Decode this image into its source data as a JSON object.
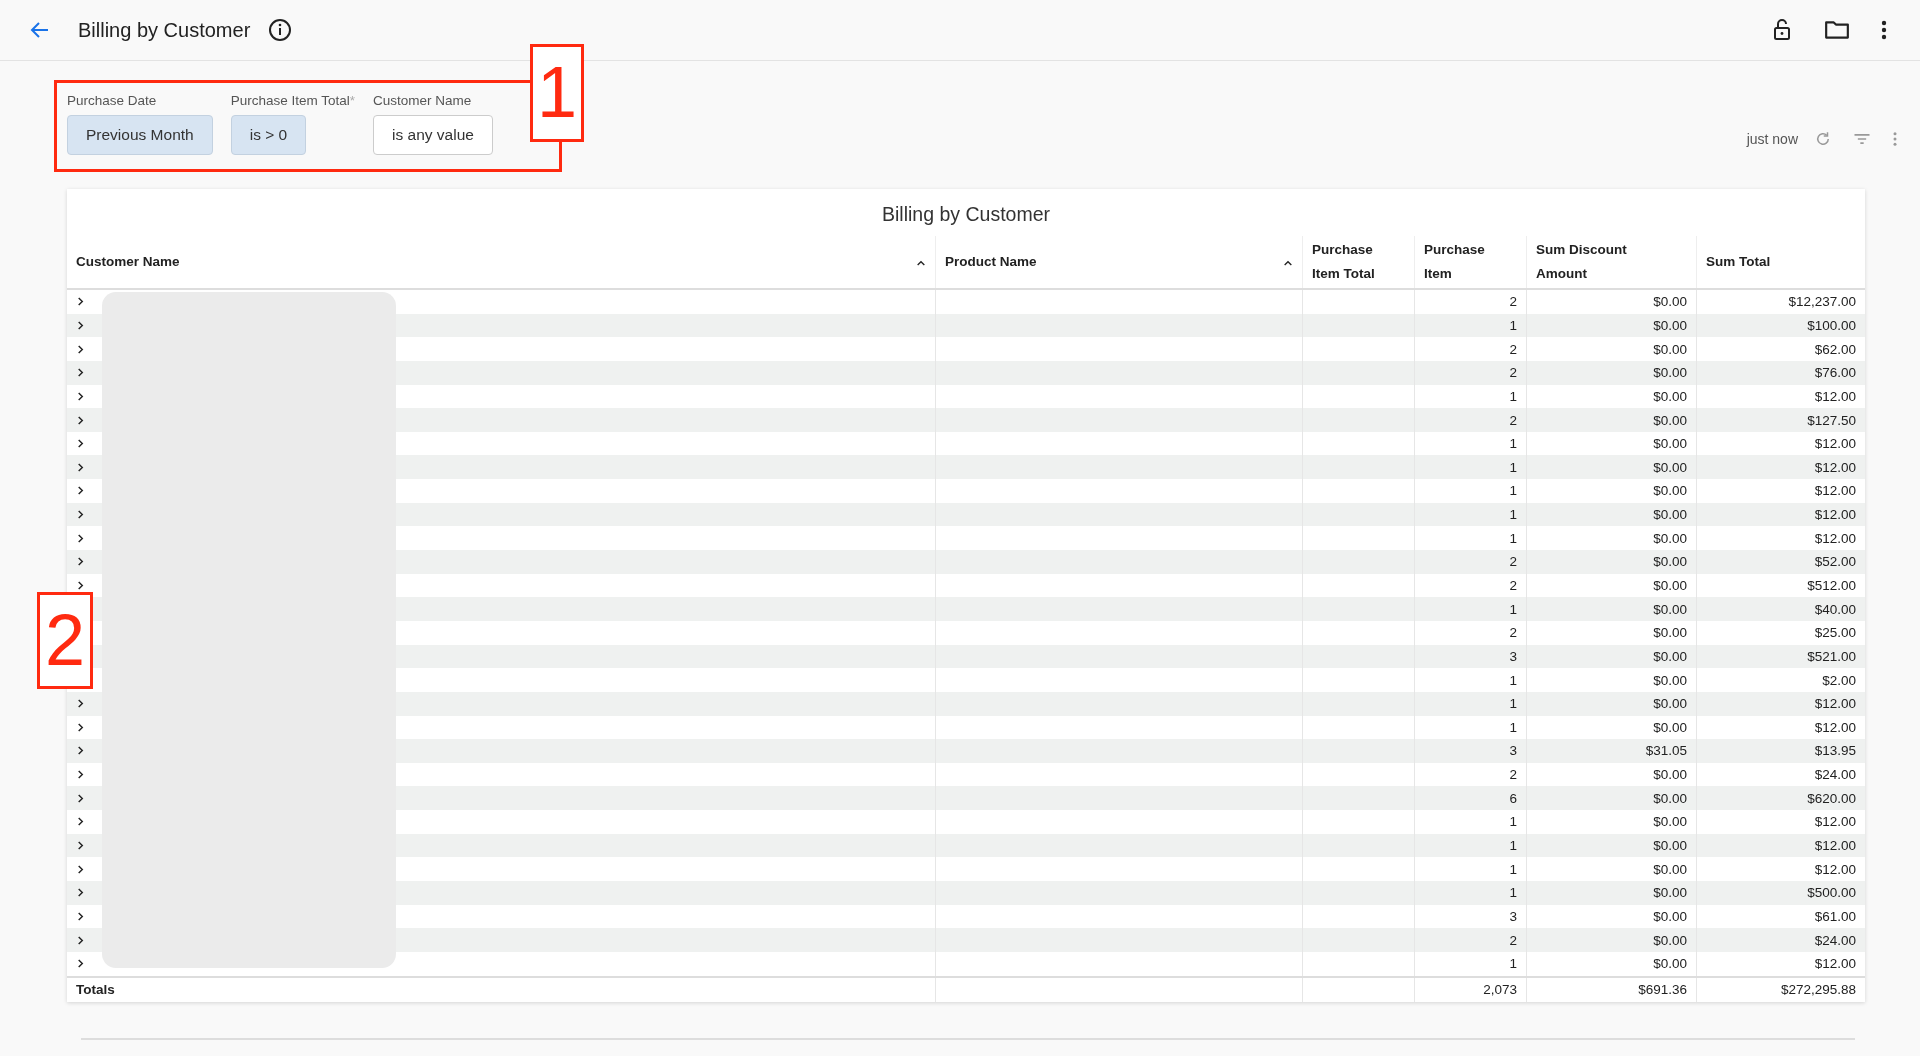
{
  "header": {
    "title": "Billing by Customer"
  },
  "filters": [
    {
      "label": "Purchase Date",
      "value": "Previous Month",
      "active": true
    },
    {
      "label": "Purchase Item Total",
      "marker": "*",
      "value": "is > 0",
      "active": true
    },
    {
      "label": "Customer Name",
      "value": "is any value",
      "active": false
    }
  ],
  "toolbar": {
    "updated": "just now"
  },
  "table": {
    "title": "Billing by Customer",
    "columns": [
      {
        "name": "Customer Name",
        "sorted": true
      },
      {
        "name": "Product Name",
        "sorted": true
      },
      {
        "name": "Purchase Item Total"
      },
      {
        "name": "Purchase Item"
      },
      {
        "name": "Sum Discount Amount"
      },
      {
        "name": "Sum Total"
      }
    ],
    "rows": [
      {
        "expanded": false,
        "purchase_item": "2",
        "discount": "$0.00",
        "total": "$12,237.00"
      },
      {
        "expanded": false,
        "purchase_item": "1",
        "discount": "$0.00",
        "total": "$100.00"
      },
      {
        "expanded": false,
        "purchase_item": "2",
        "discount": "$0.00",
        "total": "$62.00"
      },
      {
        "expanded": false,
        "purchase_item": "2",
        "discount": "$0.00",
        "total": "$76.00"
      },
      {
        "expanded": false,
        "purchase_item": "1",
        "discount": "$0.00",
        "total": "$12.00"
      },
      {
        "expanded": false,
        "purchase_item": "2",
        "discount": "$0.00",
        "total": "$127.50"
      },
      {
        "expanded": false,
        "purchase_item": "1",
        "discount": "$0.00",
        "total": "$12.00"
      },
      {
        "expanded": false,
        "purchase_item": "1",
        "discount": "$0.00",
        "total": "$12.00"
      },
      {
        "expanded": false,
        "purchase_item": "1",
        "discount": "$0.00",
        "total": "$12.00"
      },
      {
        "expanded": false,
        "purchase_item": "1",
        "discount": "$0.00",
        "total": "$12.00"
      },
      {
        "expanded": false,
        "purchase_item": "1",
        "discount": "$0.00",
        "total": "$12.00"
      },
      {
        "expanded": false,
        "purchase_item": "2",
        "discount": "$0.00",
        "total": "$52.00"
      },
      {
        "expanded": false,
        "purchase_item": "2",
        "discount": "$0.00",
        "total": "$512.00"
      },
      {
        "purchase_item": "1",
        "discount": "$0.00",
        "total": "$40.00"
      },
      {
        "purchase_item": "2",
        "discount": "$0.00",
        "total": "$25.00"
      },
      {
        "purchase_item": "3",
        "discount": "$0.00",
        "total": "$521.00"
      },
      {
        "purchase_item": "1",
        "discount": "$0.00",
        "total": "$2.00"
      },
      {
        "expanded": false,
        "purchase_item": "1",
        "discount": "$0.00",
        "total": "$12.00"
      },
      {
        "expanded": false,
        "purchase_item": "1",
        "discount": "$0.00",
        "total": "$12.00"
      },
      {
        "expanded": false,
        "purchase_item": "3",
        "discount": "$31.05",
        "total": "$13.95"
      },
      {
        "expanded": false,
        "purchase_item": "2",
        "discount": "$0.00",
        "total": "$24.00"
      },
      {
        "expanded": false,
        "purchase_item": "6",
        "discount": "$0.00",
        "total": "$620.00"
      },
      {
        "expanded": false,
        "purchase_item": "1",
        "discount": "$0.00",
        "total": "$12.00"
      },
      {
        "expanded": false,
        "purchase_item": "1",
        "discount": "$0.00",
        "total": "$12.00"
      },
      {
        "expanded": false,
        "purchase_item": "1",
        "discount": "$0.00",
        "total": "$12.00"
      },
      {
        "expanded": false,
        "purchase_item": "1",
        "discount": "$0.00",
        "total": "$500.00"
      },
      {
        "expanded": false,
        "purchase_item": "3",
        "discount": "$0.00",
        "total": "$61.00"
      },
      {
        "expanded": false,
        "purchase_item": "2",
        "discount": "$0.00",
        "total": "$24.00"
      },
      {
        "expanded": false,
        "purchase_item": "1",
        "discount": "$0.00",
        "total": "$12.00"
      }
    ],
    "totals": {
      "label": "Totals",
      "purchase_item": "2,073",
      "discount": "$691.36",
      "total": "$272,295.88"
    }
  },
  "annotations": [
    {
      "label": "1"
    },
    {
      "label": "2"
    }
  ]
}
